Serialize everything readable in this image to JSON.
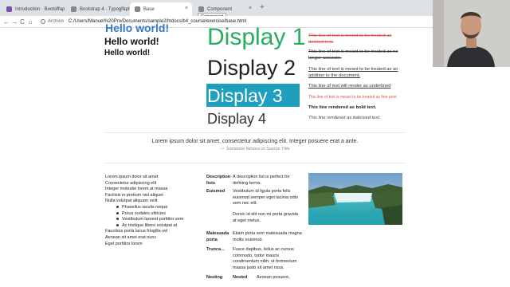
{
  "browser": {
    "tabs": [
      {
        "label": "Introduction · Bootstrap",
        "icon": "bootstrap-icon",
        "color": "#7952b3"
      },
      {
        "label": "Bootstrap 4 - Typography",
        "icon": "globe-icon",
        "color": "#4a4a4a"
      },
      {
        "label": "Base",
        "icon": "globe-icon",
        "color": "#4a4a4a"
      },
      {
        "label": "Component",
        "icon": "globe-icon",
        "color": "#4a4a4a"
      }
    ],
    "tooltip": "Component",
    "close_glyph": "×",
    "newtab_glyph": "+",
    "nav": {
      "back": "←",
      "forward": "→",
      "reload": "C",
      "home": "⌂"
    },
    "site_info": "Archivo",
    "url": "C:/Users/Manuel%20Pro/Documents/sample2/htdocs/b4_course/exercise/base.html"
  },
  "headings": {
    "h_top": "Hello world!",
    "h_second": "Hello world!",
    "h_third": "Hello world!"
  },
  "displays": {
    "d1": "Display 1",
    "d2": "Display 2",
    "d3": "Display 3",
    "d4": "Display 4"
  },
  "text_utilities": {
    "t1": "This line of text is meant to be treated as deleted text.",
    "t2": "This line of text is meant to be treated as no longer accurate.",
    "t3": "This line of text is meant to be treated as an addition to the document.",
    "t4": "This line of text will render as underlined",
    "t5": "This line of text is meant to be treated as fine print.",
    "t6": "This line rendered as bold text.",
    "t7": "This line rendered as italicized text."
  },
  "blockquote": {
    "text": "Lorem ipsum dolor sit amet, consectetur adipiscing elit. Integer posuere erat a ante.",
    "footer": "— Someone famous in Source Title"
  },
  "list": {
    "items": [
      "Lorem ipsum dolor sit amet",
      "Consectetur adipiscing elit",
      "Integer molestie lorem at massa",
      "Facilisis in pretium nisl aliquet",
      "Nulla volutpat aliquam velit"
    ],
    "sub_items": [
      "Phasellus iaculis neque",
      "Purus sodales ultricies",
      "Vestibulum laoreet porttitor sem",
      "Ac tristique libero volutpat at"
    ],
    "tail_items": [
      "Faucibus porta lacus fringilla vel",
      "Aenean sit amet erat nunc",
      "Eget porttitor lorem"
    ]
  },
  "description_list": {
    "dt1": "Description lists",
    "dd1": "A description list is perfect for defining terms.",
    "dt2": "Euismod",
    "dd2a": "Vestibulum id ligula porta felis euismod semper eget lacinia odio sem nec elit.",
    "dd2b": "Donec id elit non mi porta gravida at eget metus.",
    "dt3": "Malesuada porta",
    "dd3": "Etiam porta sem malesuada magna mollis euismod.",
    "dt4": "Trunca...",
    "dd4": "Fusce dapibus, tellus ac cursus commodo, tortor mauris condimentum nibh, ut fermentum massa justo sit amet risus.",
    "dt5": "Nesting",
    "dd5_dt": "Nested",
    "dd5_dd": "Aenean posuere,"
  },
  "colors": {
    "display1": "#27ae60",
    "display3_bg": "#1f9fbd",
    "heading_blue": "#3478c6",
    "danger": "#d9534f"
  }
}
